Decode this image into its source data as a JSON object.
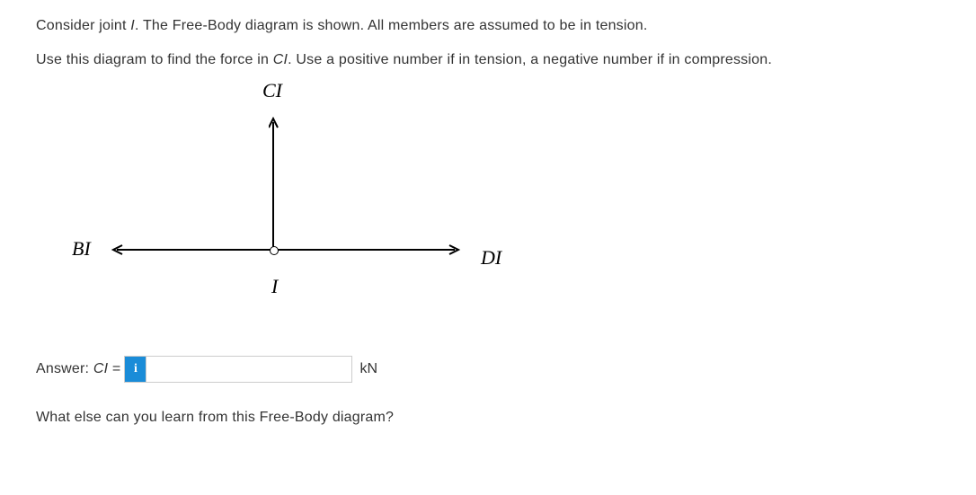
{
  "paragraph1_prefix": "Consider joint ",
  "paragraph1_italic": "I",
  "paragraph1_suffix": ". The Free-Body diagram is shown. All members are assumed to be in tension.",
  "paragraph2_prefix": "Use this diagram to find the force in ",
  "paragraph2_italic": "CI",
  "paragraph2_suffix": ". Use a positive number if in tension, a negative number if in compression.",
  "diagram": {
    "label_CI": "CI",
    "label_BI": "BI",
    "label_DI": "DI",
    "label_I": "I"
  },
  "answer": {
    "label_prefix": "Answer: ",
    "label_var": "CI",
    "label_equals": " = ",
    "info_icon": "i",
    "value": "",
    "unit": "kN"
  },
  "paragraph3": "What else can you learn from this Free-Body diagram?"
}
